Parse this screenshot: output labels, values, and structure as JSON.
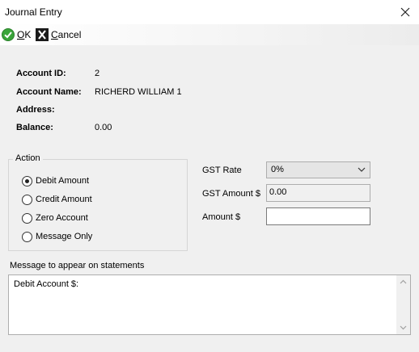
{
  "window": {
    "title": "Journal Entry",
    "close_symbol": "✕"
  },
  "toolbar": {
    "ok_accel": "O",
    "ok_rest": "K",
    "cancel_accel": "C",
    "cancel_rest": "ancel"
  },
  "info": {
    "account_id_label": "Account ID:",
    "account_id": "2",
    "account_name_label": "Account Name:",
    "account_name": "RICHERD WILLIAM 1",
    "address_label": "Address:",
    "address": "",
    "balance_label": "Balance:",
    "balance": "0.00"
  },
  "action": {
    "title": "Action",
    "options": [
      {
        "label": "Debit Amount",
        "checked": true
      },
      {
        "label": "Credit Amount",
        "checked": false
      },
      {
        "label": "Zero Account",
        "checked": false
      },
      {
        "label": "Message Only",
        "checked": false
      }
    ]
  },
  "gst": {
    "rate_label": "GST Rate",
    "rate_value": "0%",
    "amount_label": "GST Amount $",
    "amount_value": "0.00",
    "total_label": "Amount $",
    "total_value": ""
  },
  "message": {
    "label": "Message to appear on statements",
    "text": "Debit Account $:"
  },
  "icons": {
    "ok": "check-icon",
    "cancel": "x-box-icon"
  },
  "colors": {
    "ok_green": "#3aa43a",
    "window_bg": "#f0f0f0"
  }
}
